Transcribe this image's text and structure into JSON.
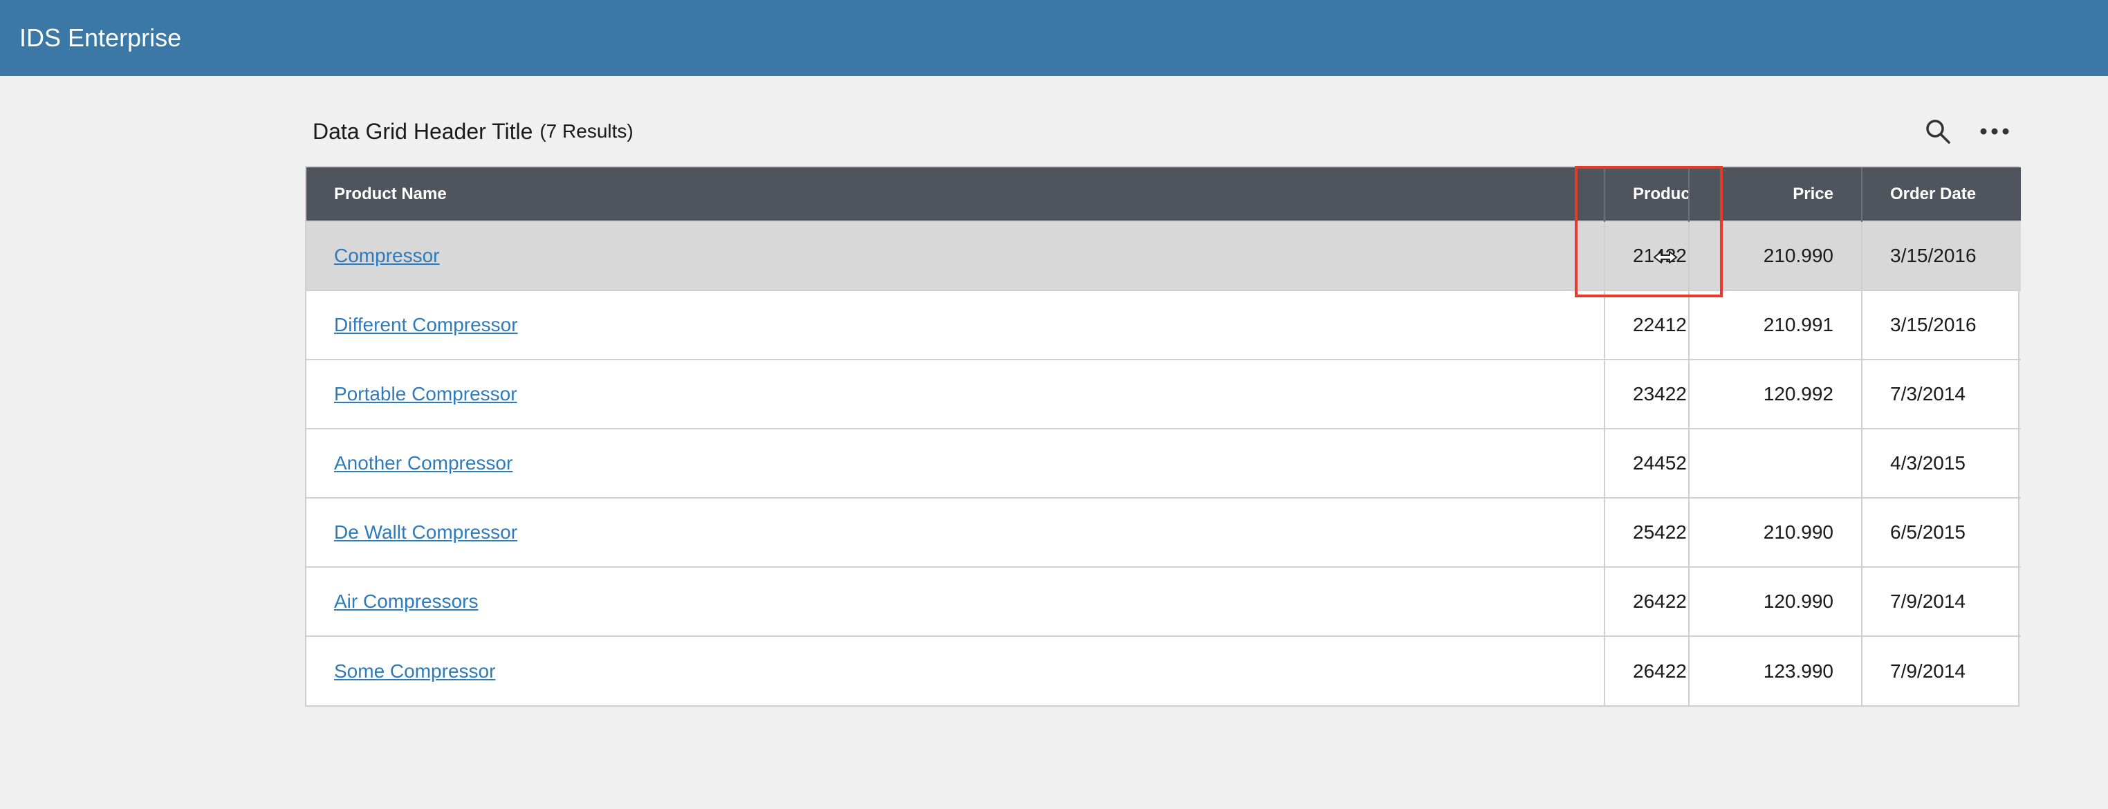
{
  "app": {
    "title": "IDS Enterprise"
  },
  "grid": {
    "title": "Data Grid Header Title",
    "count": "(7 Results)",
    "columns": [
      {
        "label": "Product Name"
      },
      {
        "label": "Produc"
      },
      {
        "label": "Price"
      },
      {
        "label": "Order Date"
      }
    ],
    "rows": [
      {
        "name": "Compressor",
        "product": "21422",
        "price": "210.990",
        "date": "3/15/2016",
        "selected": true
      },
      {
        "name": "Different Compressor",
        "product": "22412",
        "price": "210.991",
        "date": "3/15/2016"
      },
      {
        "name": "Portable Compressor",
        "product": "23422",
        "price": "120.992",
        "date": "7/3/2014"
      },
      {
        "name": "Another Compressor",
        "product": "24452",
        "price": "",
        "date": "4/3/2015"
      },
      {
        "name": "De Wallt Compressor",
        "product": "25422",
        "price": "210.990",
        "date": "6/5/2015"
      },
      {
        "name": "Air Compressors",
        "product": "26422",
        "price": "120.990",
        "date": "7/9/2014"
      },
      {
        "name": "Some Compressor",
        "product": "26422",
        "price": "123.990",
        "date": "7/9/2014"
      }
    ]
  },
  "toolbar": {
    "icons": [
      "search-icon",
      "more-actions-icon"
    ]
  },
  "colors": {
    "header_bg": "#3b78a6",
    "grid_header_bg": "#50545c",
    "link": "#2d7bbd",
    "selected_row": "#d8d8d8",
    "highlight": "#e43b2c"
  }
}
